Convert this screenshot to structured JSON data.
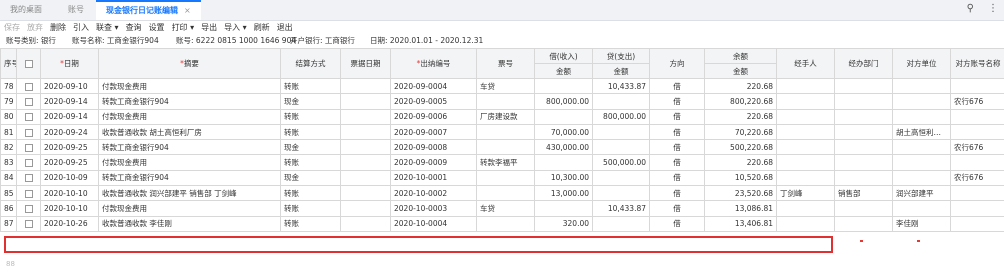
{
  "tabs": [
    "我的桌面",
    "账号",
    "现金银行日记账编辑"
  ],
  "tab_close": "×",
  "top_icons": [
    "search-icon",
    "more-icon"
  ],
  "toolbar": [
    "保存",
    "放弃",
    "删除",
    "引入",
    "联查 ▾",
    "查询",
    "设置",
    "打印 ▾",
    "导出",
    "导入 ▾",
    "刷新",
    "退出"
  ],
  "info": {
    "account_type": "账号类别: 银行",
    "account_name": "账号名称: 工商金银行904",
    "account_no": "账号: 6222 0815 1000 1646 904",
    "bank": "开户银行: 工商银行",
    "date": "日期: 2020.01.01 - 2020.12.31"
  },
  "headers": {
    "seq": "序号",
    "date": "日期",
    "summary": "摘要",
    "settle": "结算方式",
    "bill_date": "票据日期",
    "doc_no": "出纳编号",
    "bill_no": "票号",
    "debit": "借(收入)",
    "credit": "贷(支出)",
    "direction": "方向",
    "balance": "余额",
    "handler": "经手人",
    "dept": "经办部门",
    "unit": "对方单位",
    "opp_account": "对方账号名称",
    "amount": "金额",
    "required_mark": "*"
  },
  "rows": [
    {
      "seq": "78",
      "date": "2020-09-10",
      "summary": "付款现金费用",
      "settle": "转账",
      "doc_no": "2020-09-0004",
      "bill_no": "车贷",
      "debit": "",
      "credit": "10,433.87",
      "dir": "借",
      "balance": "220.68",
      "handler": "",
      "dept": "",
      "unit": "",
      "opp": ""
    },
    {
      "seq": "79",
      "date": "2020-09-14",
      "summary": "转款工商金银行904",
      "settle": "现金",
      "doc_no": "2020-09-0005",
      "bill_no": "",
      "debit": "800,000.00",
      "credit": "",
      "dir": "借",
      "balance": "800,220.68",
      "handler": "",
      "dept": "",
      "unit": "",
      "opp": "农行676"
    },
    {
      "seq": "80",
      "date": "2020-09-14",
      "summary": "付款现金费用",
      "settle": "转账",
      "doc_no": "2020-09-0006",
      "bill_no": "厂房建设款",
      "debit": "",
      "credit": "800,000.00",
      "dir": "借",
      "balance": "220.68",
      "handler": "",
      "dept": "",
      "unit": "",
      "opp": ""
    },
    {
      "seq": "81",
      "date": "2020-09-24",
      "summary": "收款普通收款 胡土高恒利厂房",
      "settle": "转账",
      "doc_no": "2020-09-0007",
      "bill_no": "",
      "debit": "70,000.00",
      "credit": "",
      "dir": "借",
      "balance": "70,220.68",
      "handler": "",
      "dept": "",
      "unit": "胡土高恒利…",
      "opp": ""
    },
    {
      "seq": "82",
      "date": "2020-09-25",
      "summary": "转款工商金银行904",
      "settle": "现金",
      "doc_no": "2020-09-0008",
      "bill_no": "",
      "debit": "430,000.00",
      "credit": "",
      "dir": "借",
      "balance": "500,220.68",
      "handler": "",
      "dept": "",
      "unit": "",
      "opp": "农行676"
    },
    {
      "seq": "83",
      "date": "2020-09-25",
      "summary": "付款现金费用",
      "settle": "转账",
      "doc_no": "2020-09-0009",
      "bill_no": "转款李福平",
      "debit": "",
      "credit": "500,000.00",
      "dir": "借",
      "balance": "220.68",
      "handler": "",
      "dept": "",
      "unit": "",
      "opp": ""
    },
    {
      "seq": "84",
      "date": "2020-10-09",
      "summary": "转款工商金银行904",
      "settle": "现金",
      "doc_no": "2020-10-0001",
      "bill_no": "",
      "debit": "10,300.00",
      "credit": "",
      "dir": "借",
      "balance": "10,520.68",
      "handler": "",
      "dept": "",
      "unit": "",
      "opp": "农行676"
    },
    {
      "seq": "85",
      "date": "2020-10-10",
      "summary": "收款普通收款 润兴部建平 销售部 丁剑峰",
      "settle": "转账",
      "doc_no": "2020-10-0002",
      "bill_no": "",
      "debit": "13,000.00",
      "credit": "",
      "dir": "借",
      "balance": "23,520.68",
      "handler": "丁剑峰",
      "dept": "销售部",
      "unit": "润兴部建平",
      "opp": ""
    },
    {
      "seq": "86",
      "date": "2020-10-10",
      "summary": "付款现金费用",
      "settle": "转账",
      "doc_no": "2020-10-0003",
      "bill_no": "车贷",
      "debit": "",
      "credit": "10,433.87",
      "dir": "借",
      "balance": "13,086.81",
      "handler": "",
      "dept": "",
      "unit": "",
      "opp": ""
    },
    {
      "seq": "87",
      "date": "2020-10-26",
      "summary": "收款普通收款 李佳刚",
      "settle": "转账",
      "doc_no": "2020-10-0004",
      "bill_no": "",
      "debit": "320.00",
      "credit": "",
      "dir": "借",
      "balance": "13,406.81",
      "handler": "",
      "dept": "",
      "unit": "李佳刚",
      "opp": ""
    }
  ],
  "footer": "88"
}
